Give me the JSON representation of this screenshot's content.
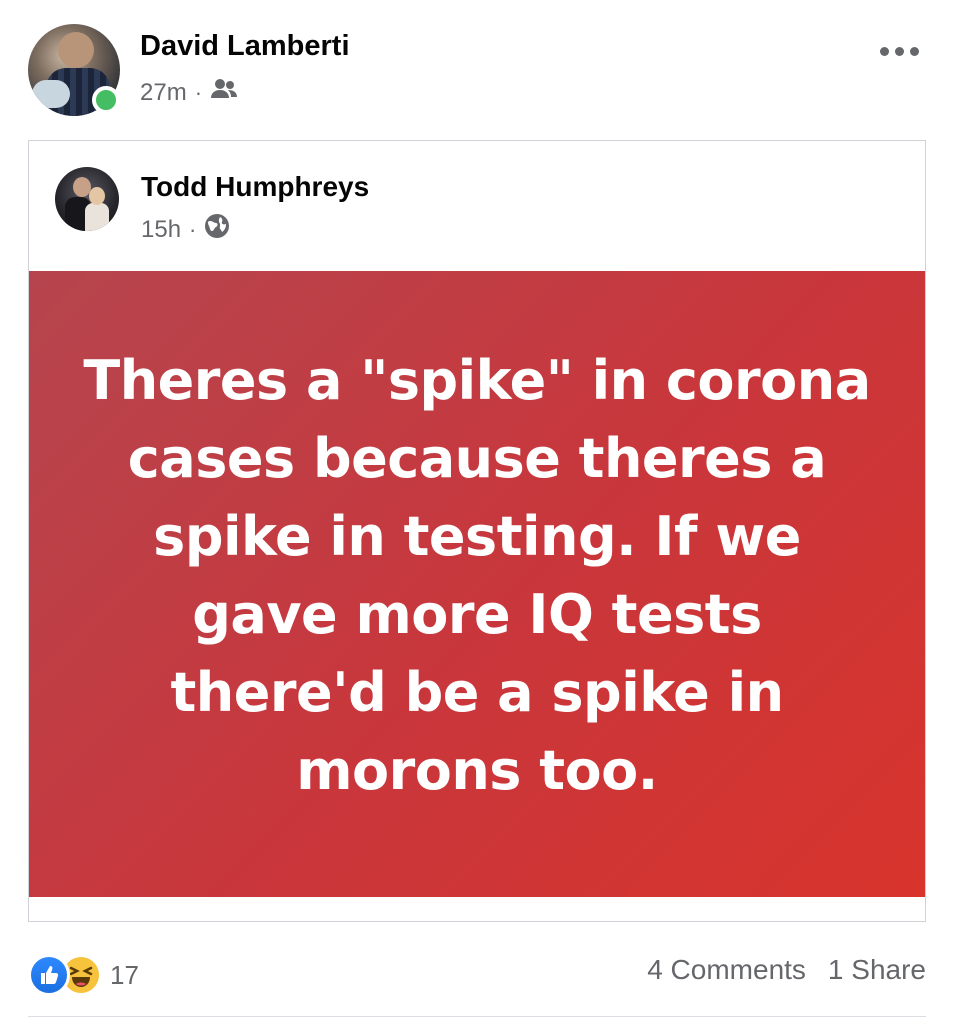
{
  "post": {
    "author": "David Lamberti",
    "time": "27m",
    "separator": "·",
    "audience_icon": "friends-icon",
    "more_icon": "more-horizontal-icon"
  },
  "shared_post": {
    "author": "Todd Humphreys",
    "time": "15h",
    "separator": "·",
    "audience_icon": "globe-icon",
    "text": "Theres a \"spike\" in corona cases because theres a spike in testing. If we gave more IQ tests there'd be a spike in morons too.",
    "background_colors": [
      "#b6454e",
      "#d8342c"
    ]
  },
  "footer": {
    "reaction_icons": [
      "like-icon",
      "haha-icon"
    ],
    "reaction_count": "17",
    "comments": "4 Comments",
    "shares": "1 Share"
  },
  "colors": {
    "online": "#45bd62",
    "secondary_text": "#65676b",
    "like_blue": "#1b6fe0",
    "haha_yellow": "#f7c33c"
  }
}
